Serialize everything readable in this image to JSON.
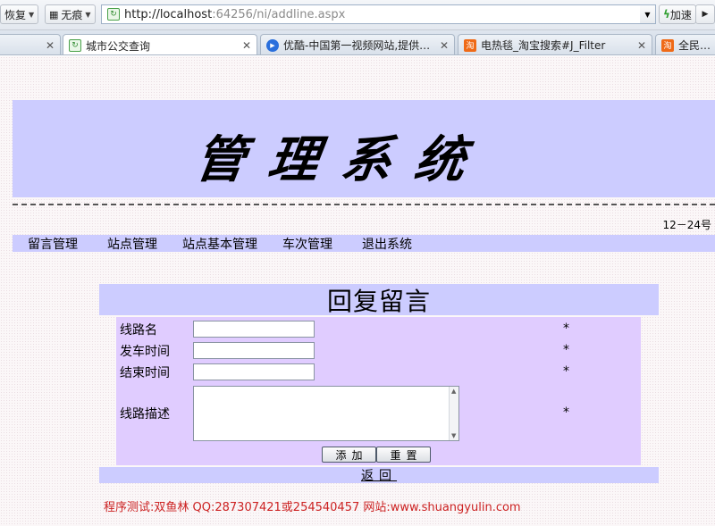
{
  "browser": {
    "back_label": "恢复",
    "trace_label": "无痕",
    "url_host": "http://localhost",
    "url_rest": ":64256/ni/addline.aspx",
    "speed_label": "加速",
    "tabs": [
      {
        "title": "城市公交查询",
        "icon": "page-icon",
        "active": true
      },
      {
        "title": "优酷-中国第一视频网站,提供视频...",
        "icon": "play-icon",
        "active": false
      },
      {
        "title": "电热毯_淘宝搜索#J_Filter",
        "icon": "taobao-icon",
        "active": false
      },
      {
        "title": "全民抢购",
        "icon": "taobao-icon",
        "active": false
      }
    ]
  },
  "page": {
    "banner_title": "管理系统",
    "date": "12－24号",
    "nav": [
      {
        "label": "留言管理"
      },
      {
        "label": "站点管理"
      },
      {
        "label": "站点基本管理"
      },
      {
        "label": "车次管理"
      },
      {
        "label": "退出系统"
      }
    ],
    "form": {
      "title": "回复留言",
      "fields": [
        {
          "label": "线路名",
          "value": "",
          "required_mark": "*"
        },
        {
          "label": "发车时间",
          "value": "",
          "required_mark": "*"
        },
        {
          "label": "结束时间",
          "value": "",
          "required_mark": "*"
        },
        {
          "label": "线路描述",
          "value": "",
          "required_mark": "*"
        }
      ],
      "add_button": "添加",
      "reset_button": "重置",
      "back_link": "返回"
    },
    "footer": "程序测试:双鱼林 QQ:287307421或254540457 网站:www.shuangyulin.com"
  },
  "colors": {
    "banner": "#ccccff",
    "form_body": "#e0ccff",
    "footer_text": "#cc2222"
  }
}
